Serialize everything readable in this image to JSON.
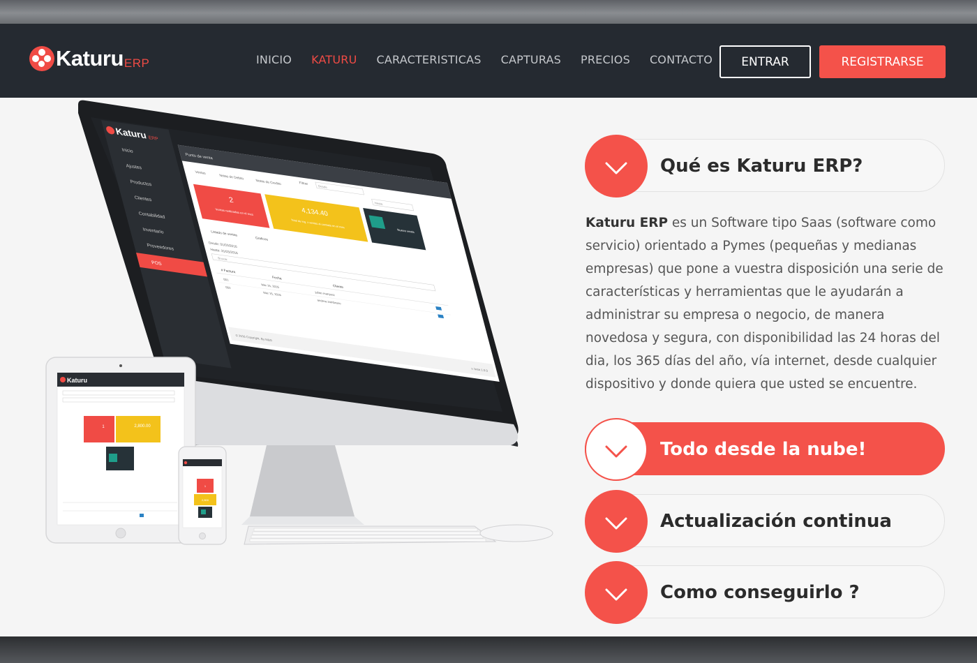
{
  "brand": {
    "name": "Katuru",
    "suffix": "ERP",
    "accent": "#f4524a",
    "nav_bg": "#252a31"
  },
  "nav": {
    "links": [
      {
        "label": "INICIO"
      },
      {
        "label": "KATURU",
        "active": true
      },
      {
        "label": "CARACTERISTICAS"
      },
      {
        "label": "CAPTURAS"
      },
      {
        "label": "PRECIOS"
      },
      {
        "label": "CONTACTO"
      }
    ],
    "login_label": "ENTRAR",
    "register_label": "REGISTRARSE"
  },
  "accordion": {
    "items": [
      {
        "title": "Qué es Katuru ERP?",
        "expanded": true,
        "icon": "chevron-down-icon"
      },
      {
        "title": "Todo desde la nube!",
        "highlighted": true,
        "icon": "chevron-down-icon"
      },
      {
        "title": "Actualización continua",
        "icon": "chevron-down-icon"
      },
      {
        "title": "Como conseguirlo ?",
        "icon": "chevron-down-icon"
      }
    ],
    "description_bold": "Katuru ERP",
    "description_rest": " es un Software tipo Saas (software como servicio) orientado a Pymes (pequeñas y medianas empresas) que pone a vuestra disposición una serie de características y herramientas que le ayudarán a administrar su empresa o negocio, de manera novedosa y segura, con disponibilidad las 24 horas del dia, los 365 días del año, vía internet, desde cualquier dispositivo y donde quiera que usted se encuentre."
  },
  "illustration": {
    "app_brand": "Katuru",
    "app_brand_suffix": "ERP",
    "sidebar": [
      "Inicio",
      "Ajustes",
      "Productos",
      "Clientes",
      "Contabilidad",
      "Inventario",
      "Proveedores",
      "POS"
    ],
    "panel_title": "Punto de venta",
    "tabs": [
      "Ventas",
      "Notas de Debito",
      "Notas de Credito"
    ],
    "filter_label": "Filtrar",
    "from_placeholder": "Desde",
    "to_placeholder": "Hasta",
    "cards": [
      {
        "value": "2",
        "label": "Ventas realizadas en el mes",
        "color": "#f04b45"
      },
      {
        "value": "4,134.40",
        "label": "Total de ing. x ventas al contado en el mes",
        "color": "#f3c21b"
      },
      {
        "value": "",
        "label": "Nueva venta",
        "color": "#1f9e8a"
      }
    ],
    "subtabs": [
      "Listado de ventas",
      "Graficos"
    ],
    "desde_label": "Desde: 01/03/2016",
    "hasta_label": "Hasta: 31/03/2016",
    "search_placeholder": "Buscar",
    "table_headers": [
      "# Factura",
      "Fecha",
      "Cliente"
    ],
    "rows": [
      {
        "n": "001",
        "fecha": "Mar 15, 2016",
        "cliente": "julian marquez"
      },
      {
        "n": "002",
        "fecha": "Mar 15, 2016",
        "cliente": "andrea zambrano"
      }
    ],
    "footer": "© 2016 Copyright. By M&G",
    "version": "v. beta 1.0.0",
    "tablet_card1": "1",
    "tablet_card2": "2,800.00",
    "phone_card1": "1",
    "phone_card2": "2,800"
  }
}
